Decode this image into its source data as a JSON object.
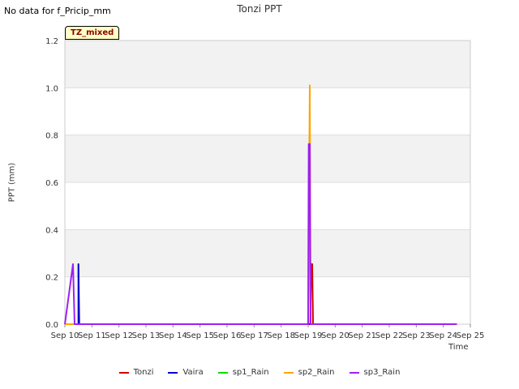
{
  "no_data_note": "No data for f_Pricip_mm",
  "badge": "TZ_mixed",
  "chart_data": {
    "type": "line",
    "title": "Tonzi PPT",
    "xlabel": "Time",
    "ylabel": "PPT (mm)",
    "xlim": [
      10,
      25
    ],
    "ylim": [
      0,
      1.2
    ],
    "x_ticks": [
      10,
      11,
      12,
      13,
      14,
      15,
      16,
      17,
      18,
      19,
      20,
      21,
      22,
      23,
      24,
      25
    ],
    "x_tick_labels": [
      "Sep 10",
      "Sep 11",
      "Sep 12",
      "Sep 13",
      "Sep 14",
      "Sep 15",
      "Sep 16",
      "Sep 17",
      "Sep 18",
      "Sep 19",
      "Sep 20",
      "Sep 21",
      "Sep 22",
      "Sep 23",
      "Sep 24",
      "Sep 25"
    ],
    "y_ticks": [
      0.0,
      0.2,
      0.4,
      0.6,
      0.8,
      1.0,
      1.2
    ],
    "y_tick_labels": [
      "0.0",
      "0.2",
      "0.4",
      "0.6",
      "0.8",
      "1.0",
      "1.2"
    ],
    "grid": true,
    "legend_position": "bottom",
    "series": [
      {
        "name": "Tonzi",
        "color": "#cc0000",
        "points": [
          [
            19.08,
            0
          ],
          [
            19.11,
            0.254
          ],
          [
            19.15,
            0.254
          ],
          [
            19.18,
            0
          ]
        ]
      },
      {
        "name": "Vaira",
        "color": "#0000cc",
        "points": [
          [
            10.0,
            0
          ],
          [
            10.5,
            0
          ],
          [
            10.5,
            0.254
          ],
          [
            10.53,
            0
          ],
          [
            24.5,
            0
          ]
        ]
      },
      {
        "name": "sp1_Rain",
        "color": "#00dd00",
        "points": []
      },
      {
        "name": "sp2_Rain",
        "color": "#ffa500",
        "points": [
          [
            10.0,
            0
          ],
          [
            19.0,
            0
          ],
          [
            19.06,
            1.01
          ],
          [
            19.09,
            0
          ],
          [
            24.5,
            0
          ]
        ]
      },
      {
        "name": "sp3_Rain",
        "color": "#a020f0",
        "points": [
          [
            10.0,
            0
          ],
          [
            10.3,
            0.254
          ],
          [
            10.36,
            0
          ],
          [
            19.0,
            0
          ],
          [
            19.02,
            0.762
          ],
          [
            19.06,
            0.762
          ],
          [
            19.09,
            0
          ],
          [
            24.5,
            0
          ]
        ]
      }
    ]
  }
}
